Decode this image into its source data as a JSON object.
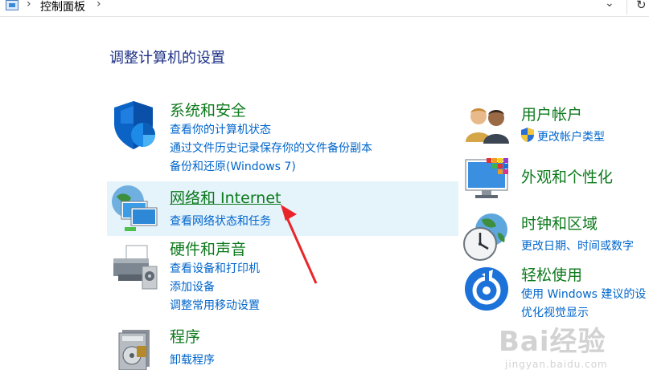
{
  "address_bar": {
    "crumb": "控制面板"
  },
  "heading": "调整计算机的设置",
  "left": [
    {
      "title": "系统和安全",
      "links": [
        "查看你的计算机状态",
        "通过文件历史记录保存你的文件备份副本",
        "备份和还原(Windows 7)"
      ],
      "icon": "shield-icon"
    },
    {
      "title": "网络和 Internet",
      "links": [
        "查看网络状态和任务"
      ],
      "icon": "network-icon"
    },
    {
      "title": "硬件和声音",
      "links": [
        "查看设备和打印机",
        "添加设备",
        "调整常用移动设置"
      ],
      "icon": "printer-icon"
    },
    {
      "title": "程序",
      "links": [
        "卸载程序"
      ],
      "icon": "programs-icon"
    }
  ],
  "right": [
    {
      "title": "用户帐户",
      "links": [
        "更改帐户类型"
      ],
      "icon": "users-icon"
    },
    {
      "title": "外观和个性化",
      "links": [],
      "icon": "monitor-icon"
    },
    {
      "title": "时钟和区域",
      "links": [
        "更改日期、时间或数字"
      ],
      "icon": "clock-icon"
    },
    {
      "title": "轻松使用",
      "links": [
        "使用 Windows 建议的设",
        "优化视觉显示"
      ],
      "icon": "ease-icon"
    }
  ],
  "watermark": {
    "main": "Bai经验",
    "sub": "jingyan.baidu.com"
  },
  "colors": {
    "title_green": "#0d7a1c",
    "link_blue": "#0066cc",
    "hover_bg": "#e5f3fb",
    "arrow_red": "#e8262a"
  }
}
